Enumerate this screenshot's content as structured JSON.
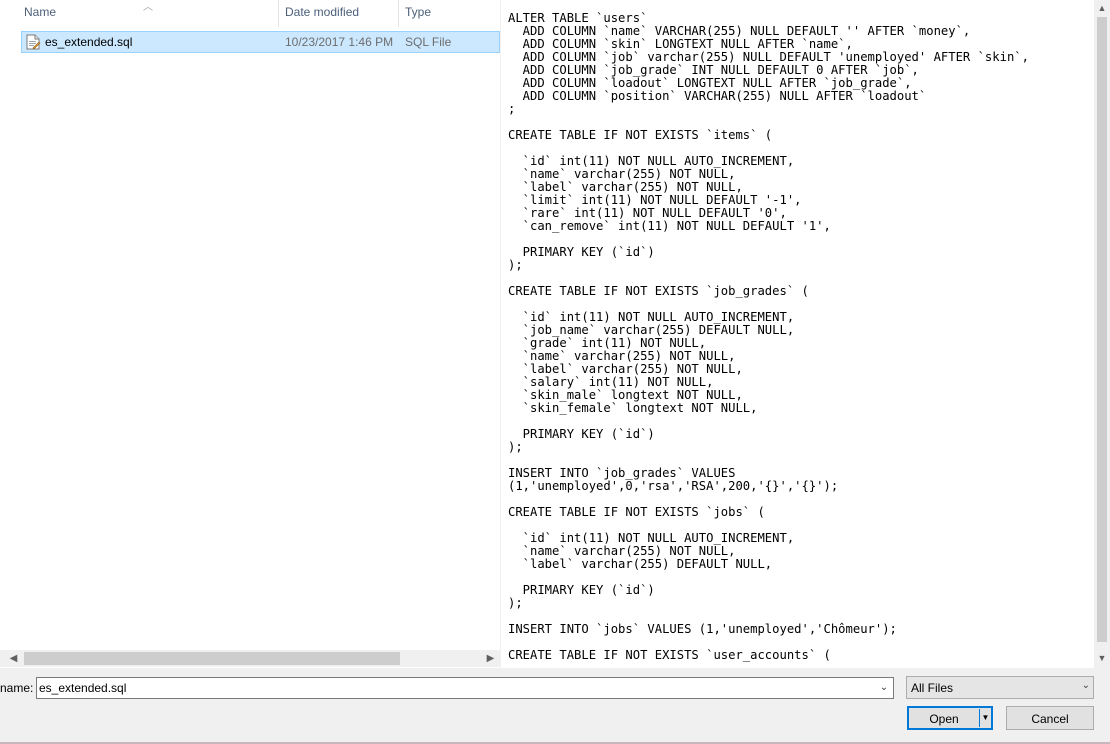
{
  "file_list": {
    "columns": {
      "name": "Name",
      "date_modified": "Date modified",
      "type": "Type"
    },
    "sort_icon": "sort-ascending-icon",
    "rows": [
      {
        "name": "es_extended.sql",
        "date_modified": "10/23/2017 1:46 PM",
        "type": "SQL File",
        "icon": "sql-file-icon",
        "selected": true
      }
    ]
  },
  "preview": {
    "text": "ALTER TABLE `users`\n  ADD COLUMN `name` VARCHAR(255) NULL DEFAULT '' AFTER `money`,\n  ADD COLUMN `skin` LONGTEXT NULL AFTER `name`,\n  ADD COLUMN `job` varchar(255) NULL DEFAULT 'unemployed' AFTER `skin`,\n  ADD COLUMN `job_grade` INT NULL DEFAULT 0 AFTER `job`,\n  ADD COLUMN `loadout` LONGTEXT NULL AFTER `job_grade`,\n  ADD COLUMN `position` VARCHAR(255) NULL AFTER `loadout`\n;\n\nCREATE TABLE IF NOT EXISTS `items` (\n\n  `id` int(11) NOT NULL AUTO_INCREMENT,\n  `name` varchar(255) NOT NULL,\n  `label` varchar(255) NOT NULL,\n  `limit` int(11) NOT NULL DEFAULT '-1',\n  `rare` int(11) NOT NULL DEFAULT '0',\n  `can_remove` int(11) NOT NULL DEFAULT '1',\n\n  PRIMARY KEY (`id`)\n);\n\nCREATE TABLE IF NOT EXISTS `job_grades` (\n\n  `id` int(11) NOT NULL AUTO_INCREMENT,\n  `job_name` varchar(255) DEFAULT NULL,\n  `grade` int(11) NOT NULL,\n  `name` varchar(255) NOT NULL,\n  `label` varchar(255) NOT NULL,\n  `salary` int(11) NOT NULL,\n  `skin_male` longtext NOT NULL,\n  `skin_female` longtext NOT NULL,\n\n  PRIMARY KEY (`id`)\n);\n\nINSERT INTO `job_grades` VALUES\n(1,'unemployed',0,'rsa','RSA',200,'{}','{}');\n\nCREATE TABLE IF NOT EXISTS `jobs` (\n\n  `id` int(11) NOT NULL AUTO_INCREMENT,\n  `name` varchar(255) NOT NULL,\n  `label` varchar(255) DEFAULT NULL,\n\n  PRIMARY KEY (`id`)\n);\n\nINSERT INTO `jobs` VALUES (1,'unemployed','Chômeur');\n\nCREATE TABLE IF NOT EXISTS `user_accounts` ("
  },
  "bottom_bar": {
    "file_name_label": "name:",
    "file_name_value": "es_extended.sql",
    "filter_value": "All Files",
    "open_label": "Open",
    "cancel_label": "Cancel"
  },
  "colors": {
    "selection_bg": "#cce8ff",
    "selection_border": "#99d1ff",
    "accent": "#0078d7",
    "header_text": "#4c607a"
  }
}
